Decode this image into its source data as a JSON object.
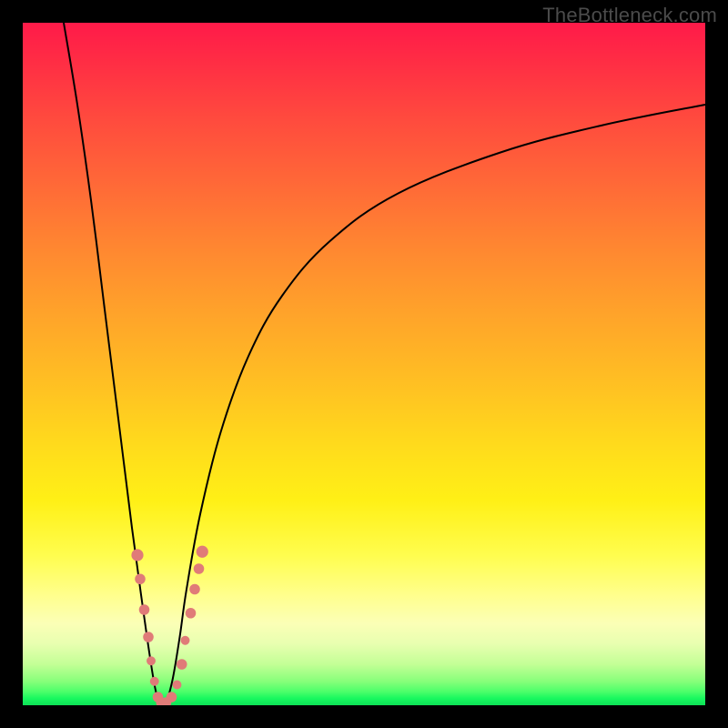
{
  "watermark": "TheBottleneck.com",
  "colors": {
    "frame": "#000000",
    "curve": "#000000",
    "marker": "#e07b78"
  },
  "chart_data": {
    "type": "line",
    "title": "",
    "xlabel": "",
    "ylabel": "",
    "xlim": [
      0,
      100
    ],
    "ylim": [
      0,
      100
    ],
    "series": [
      {
        "name": "left-branch",
        "x": [
          6,
          8,
          10,
          12,
          14,
          16,
          17.5,
          18.5,
          19.3,
          20
        ],
        "y": [
          100,
          88,
          74,
          58,
          42,
          26,
          15,
          8,
          3,
          0
        ]
      },
      {
        "name": "right-branch",
        "x": [
          21,
          22,
          23,
          24,
          26,
          29,
          33,
          38,
          45,
          55,
          70,
          85,
          100
        ],
        "y": [
          0,
          4,
          10,
          17,
          28,
          40,
          51,
          60,
          68,
          75,
          81,
          85,
          88
        ]
      }
    ],
    "markers": {
      "name": "data-points",
      "points": [
        {
          "x": 16.8,
          "y": 22.0,
          "r": 1.6
        },
        {
          "x": 17.2,
          "y": 18.5,
          "r": 1.4
        },
        {
          "x": 17.8,
          "y": 14.0,
          "r": 1.4
        },
        {
          "x": 18.4,
          "y": 10.0,
          "r": 1.4
        },
        {
          "x": 18.8,
          "y": 6.5,
          "r": 1.2
        },
        {
          "x": 19.3,
          "y": 3.5,
          "r": 1.2
        },
        {
          "x": 19.8,
          "y": 1.2,
          "r": 1.4
        },
        {
          "x": 20.3,
          "y": 0.4,
          "r": 1.4
        },
        {
          "x": 21.0,
          "y": 0.4,
          "r": 1.4
        },
        {
          "x": 21.8,
          "y": 1.2,
          "r": 1.4
        },
        {
          "x": 22.6,
          "y": 3.0,
          "r": 1.2
        },
        {
          "x": 23.3,
          "y": 6.0,
          "r": 1.4
        },
        {
          "x": 23.8,
          "y": 9.5,
          "r": 1.2
        },
        {
          "x": 24.6,
          "y": 13.5,
          "r": 1.4
        },
        {
          "x": 25.2,
          "y": 17.0,
          "r": 1.4
        },
        {
          "x": 25.8,
          "y": 20.0,
          "r": 1.4
        },
        {
          "x": 26.3,
          "y": 22.5,
          "r": 1.6
        }
      ]
    }
  }
}
